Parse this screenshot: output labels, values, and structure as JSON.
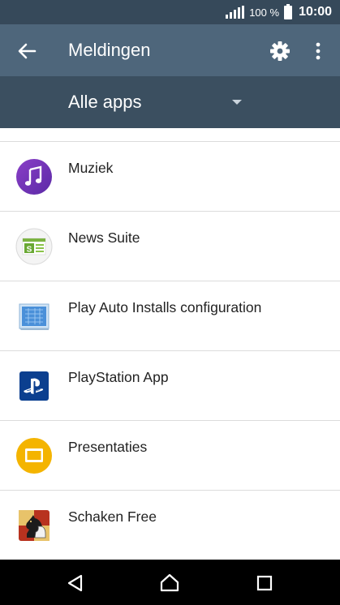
{
  "status_bar": {
    "battery_percent": "100 %",
    "clock": "10:00"
  },
  "toolbar": {
    "title": "Meldingen",
    "back_icon": "arrow-back-icon",
    "settings_icon": "gear-icon",
    "menu_icon": "more-vertical-icon"
  },
  "filter": {
    "selected": "Alle apps",
    "dropdown_icon": "caret-down-icon"
  },
  "apps": [
    {
      "name": "Muziek",
      "icon": "music-icon"
    },
    {
      "name": "News Suite",
      "icon": "news-suite-icon"
    },
    {
      "name": "Play Auto Installs configuration",
      "icon": "blueprint-icon"
    },
    {
      "name": "PlayStation App",
      "icon": "playstation-icon"
    },
    {
      "name": "Presentaties",
      "icon": "presentation-icon"
    },
    {
      "name": "Schaken Free",
      "icon": "chess-knight-icon"
    }
  ],
  "nav_bar": {
    "back_icon": "nav-back-icon",
    "home_icon": "nav-home-icon",
    "recents_icon": "nav-recents-icon"
  },
  "colors": {
    "status_bar": "#36495a",
    "toolbar": "#4e667b",
    "filter_bar": "#3b4f60",
    "divider": "#dcdcdc"
  }
}
